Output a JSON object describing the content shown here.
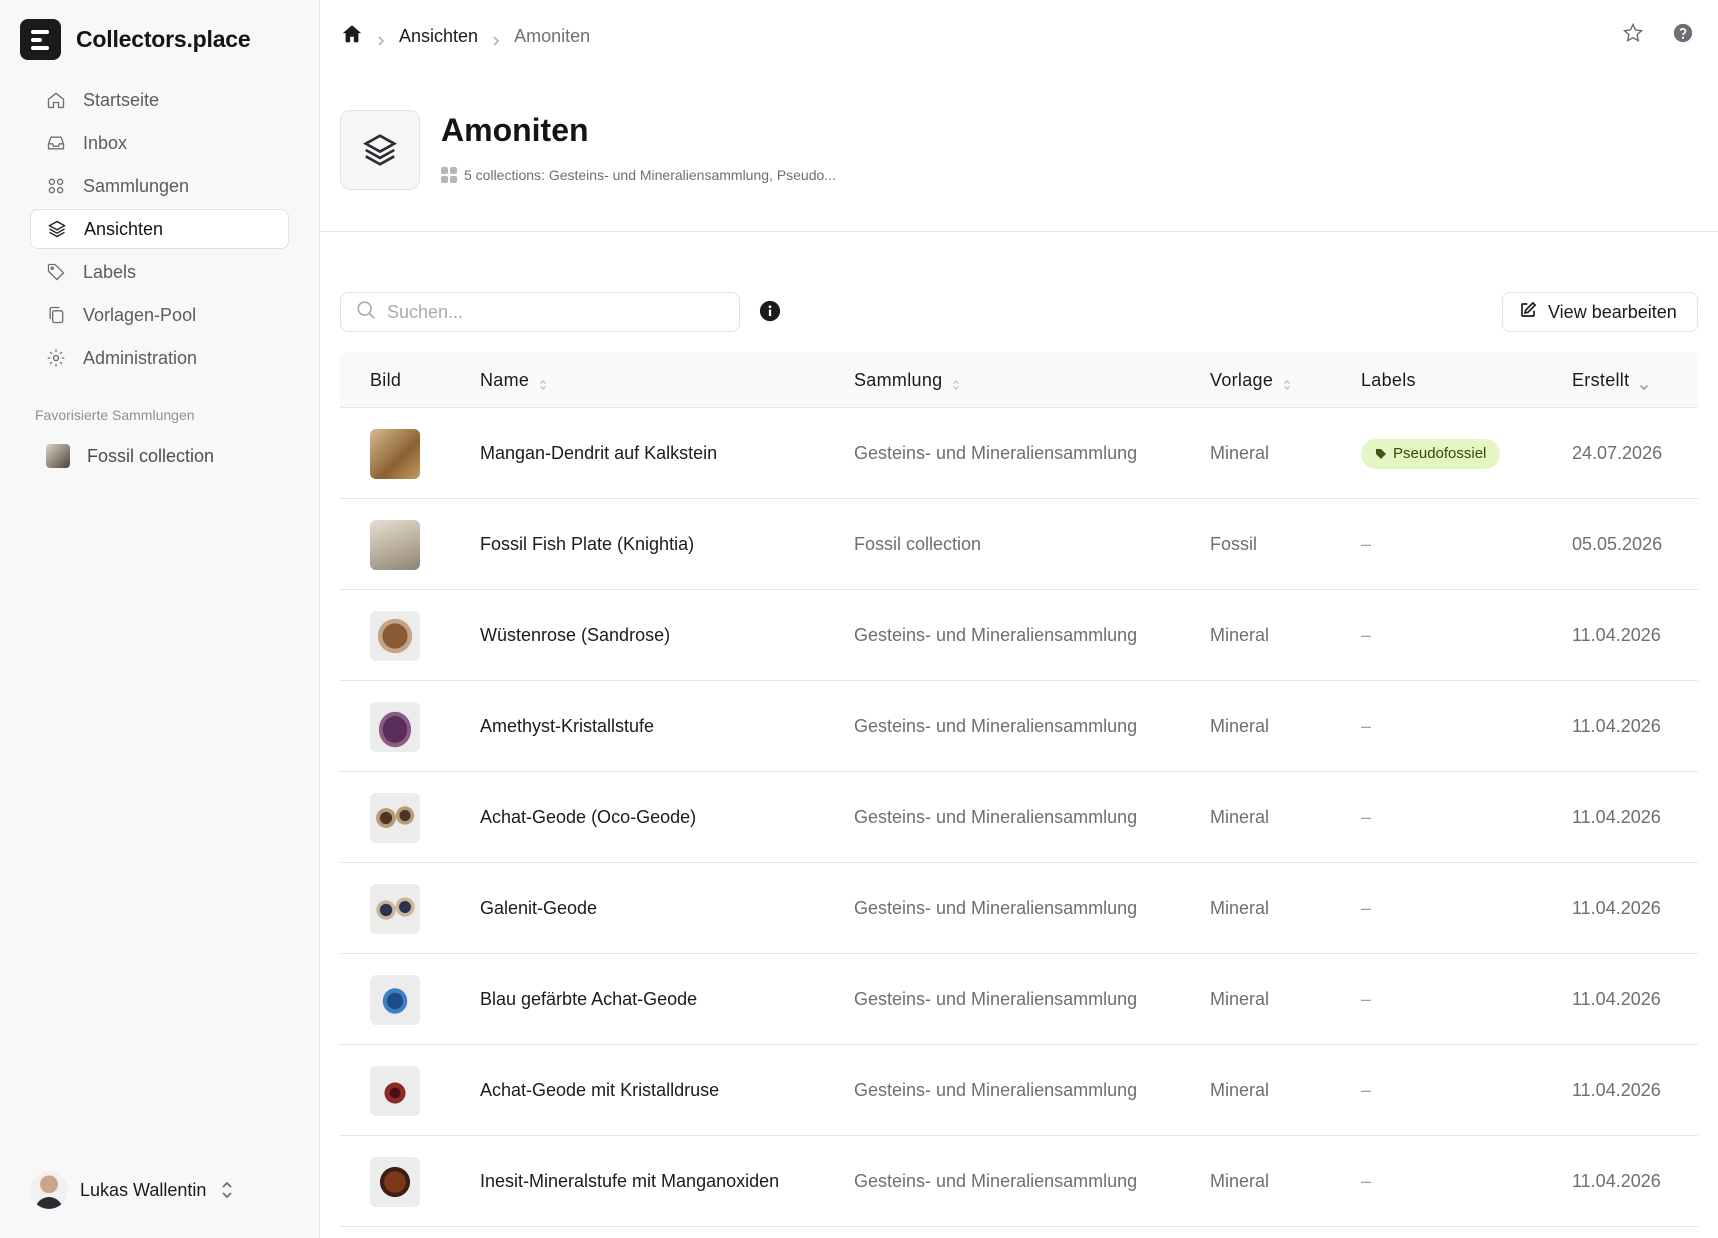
{
  "app": {
    "brand": "Collectors.place"
  },
  "sidebar": {
    "items": [
      {
        "label": "Startseite",
        "icon": "home-icon"
      },
      {
        "label": "Inbox",
        "icon": "inbox-icon"
      },
      {
        "label": "Sammlungen",
        "icon": "grid-icon"
      },
      {
        "label": "Ansichten",
        "icon": "layers-icon",
        "active": true
      },
      {
        "label": "Labels",
        "icon": "tag-icon"
      },
      {
        "label": "Vorlagen-Pool",
        "icon": "copy-icon"
      },
      {
        "label": "Administration",
        "icon": "gear-icon"
      }
    ],
    "favorites_title": "Favorisierte Sammlungen",
    "favorites": [
      {
        "label": "Fossil collection"
      }
    ],
    "user": {
      "name": "Lukas Wallentin"
    }
  },
  "breadcrumb": {
    "items": [
      "Ansichten",
      "Amoniten"
    ]
  },
  "header": {
    "title": "Amoniten",
    "meta": "5 collections: Gesteins- und Mineraliensammlung, Pseudo..."
  },
  "toolbar": {
    "search_placeholder": "Suchen...",
    "edit_label": "View bearbeiten"
  },
  "table": {
    "columns": {
      "image": "Bild",
      "name": "Name",
      "collection": "Sammlung",
      "template": "Vorlage",
      "labels": "Labels",
      "created": "Erstellt"
    },
    "rows": [
      {
        "name": "Mangan-Dendrit auf Kalkstein",
        "collection": "Gesteins- und Mineraliensammlung",
        "template": "Mineral",
        "labels": "Pseudofossiel",
        "created": "24.07.2026"
      },
      {
        "name": "Fossil Fish Plate (Knightia)",
        "collection": "Fossil collection",
        "template": "Fossil",
        "labels": "–",
        "created": "05.05.2026"
      },
      {
        "name": "Wüstenrose (Sandrose)",
        "collection": "Gesteins- und Mineraliensammlung",
        "template": "Mineral",
        "labels": "–",
        "created": "11.04.2026"
      },
      {
        "name": "Amethyst-Kristallstufe",
        "collection": "Gesteins- und Mineraliensammlung",
        "template": "Mineral",
        "labels": "–",
        "created": "11.04.2026"
      },
      {
        "name": "Achat-Geode (Oco-Geode)",
        "collection": "Gesteins- und Mineraliensammlung",
        "template": "Mineral",
        "labels": "–",
        "created": "11.04.2026"
      },
      {
        "name": "Galenit-Geode",
        "collection": "Gesteins- und Mineraliensammlung",
        "template": "Mineral",
        "labels": "–",
        "created": "11.04.2026"
      },
      {
        "name": "Blau gefärbte Achat-Geode",
        "collection": "Gesteins- und Mineraliensammlung",
        "template": "Mineral",
        "labels": "–",
        "created": "11.04.2026"
      },
      {
        "name": "Achat-Geode mit Kristalldruse",
        "collection": "Gesteins- und Mineraliensammlung",
        "template": "Mineral",
        "labels": "–",
        "created": "11.04.2026"
      },
      {
        "name": "Inesit-Mineralstufe mit Manganoxiden",
        "collection": "Gesteins- und Mineraliensammlung",
        "template": "Mineral",
        "labels": "–",
        "created": "11.04.2026"
      }
    ]
  },
  "colors": {
    "label_badge_bg": "#e3f6c4",
    "label_badge_text": "#2f4a10",
    "sidebar_bg": "#f8f8f8"
  }
}
